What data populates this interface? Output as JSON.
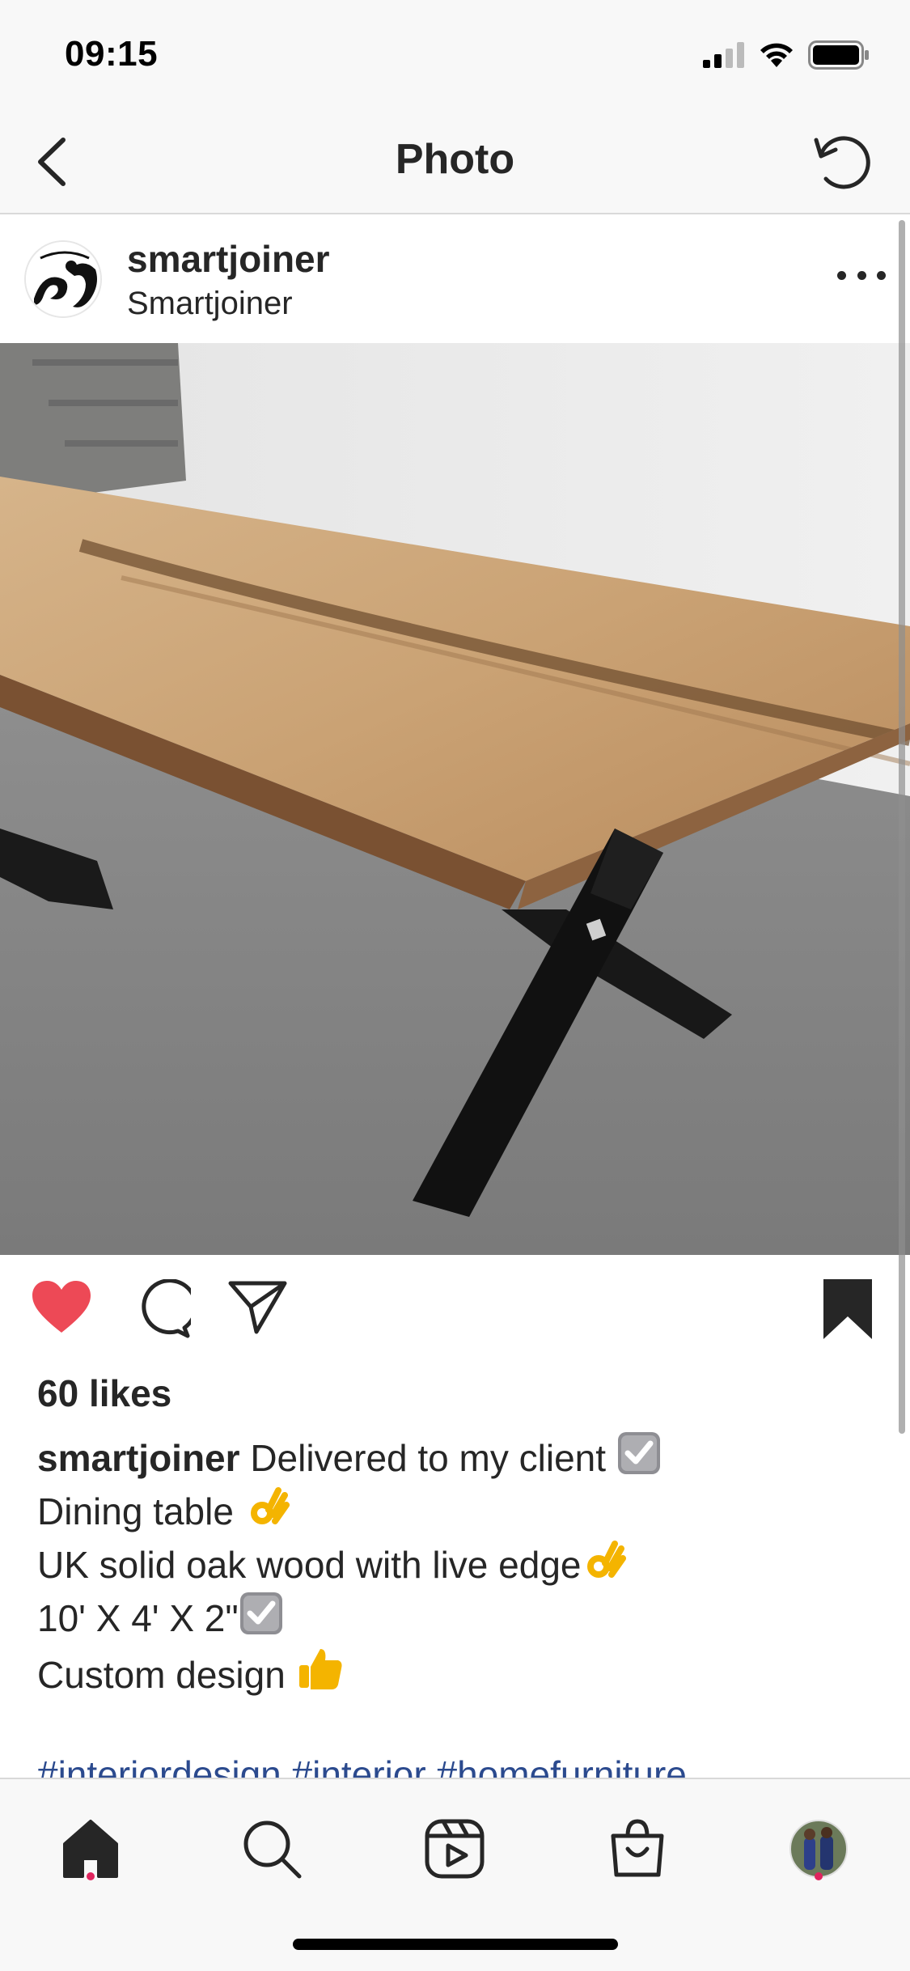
{
  "status_bar": {
    "time": "09:15"
  },
  "nav": {
    "title": "Photo"
  },
  "post": {
    "username": "smartjoiner",
    "location": "Smartjoiner",
    "likes": "60 likes",
    "caption": {
      "author": "smartjoiner",
      "line1": "Delivered to my client",
      "line2": "Dining table",
      "line3": "UK solid oak wood with live edge",
      "line4": "10' X 4' X 2\"",
      "line5": "Custom design",
      "hashtags": "#interiordesign #interior #homefurniture"
    },
    "liked": true,
    "saved": true
  },
  "icons": {
    "back": "chevron-left-icon",
    "refresh": "refresh-icon",
    "more": "more-horizontal-icon",
    "like": "heart-icon",
    "comment": "comment-icon",
    "share": "send-icon",
    "save": "bookmark-icon",
    "home": "home-icon",
    "search": "search-icon",
    "reels": "reels-icon",
    "shop": "shop-bag-icon",
    "profile": "profile-avatar"
  },
  "colors": {
    "like": "#ed4956",
    "hashtag": "#2b4a8e",
    "notification_dot": "#e0245e"
  }
}
